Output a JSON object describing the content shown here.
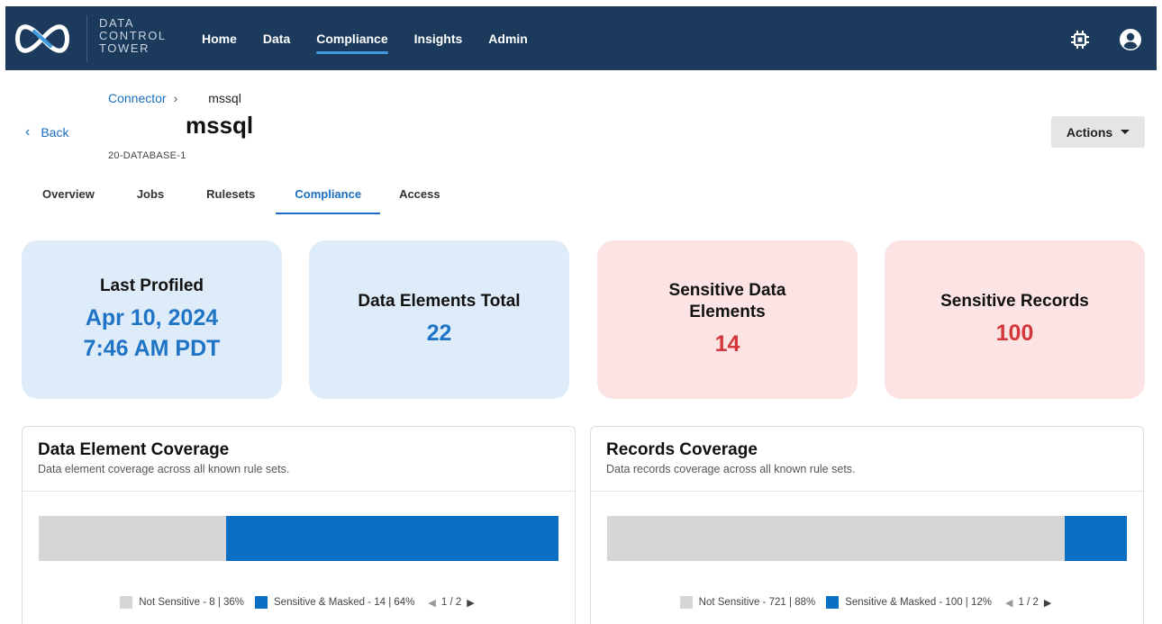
{
  "brand": {
    "line1": "DATA",
    "line2": "CONTROL",
    "line3": "TOWER"
  },
  "nav": {
    "items": [
      {
        "label": "Home"
      },
      {
        "label": "Data"
      },
      {
        "label": "Compliance",
        "active": true
      },
      {
        "label": "Insights"
      },
      {
        "label": "Admin"
      }
    ]
  },
  "header": {
    "breadcrumb_parent": "Connector",
    "breadcrumb_sep": "›",
    "breadcrumb_current": "mssql",
    "back_label": "Back",
    "title": "mssql",
    "subtitle": "20-DATABASE-1",
    "actions_label": "Actions"
  },
  "tabs": [
    {
      "label": "Overview"
    },
    {
      "label": "Jobs"
    },
    {
      "label": "Rulesets"
    },
    {
      "label": "Compliance",
      "active": true
    },
    {
      "label": "Access"
    }
  ],
  "stats": {
    "last_profiled": {
      "label": "Last Profiled",
      "value_line1": "Apr 10, 2024",
      "value_line2": "7:46 AM PDT"
    },
    "data_elements_total": {
      "label": "Data Elements Total",
      "value": "22"
    },
    "sensitive_data_elements": {
      "label_line1": "Sensitive Data",
      "label_line2": "Elements",
      "value": "14"
    },
    "sensitive_records": {
      "label": "Sensitive Records",
      "value": "100"
    }
  },
  "colors": {
    "nav_bg": "#1b3a5c",
    "accent": "#1a6fc0",
    "not_sensitive": "#d6d6d6",
    "sensitive_masked": "#0a6fc2",
    "sensitive_value": "#d4373a"
  },
  "element_coverage": {
    "title": "Data Element Coverage",
    "description": "Data element coverage across all known rule sets.",
    "not_sensitive_fraction": 0.36,
    "sensitive_fraction": 0.64,
    "legend_not_sensitive": "Not Sensitive - 8 | 36%",
    "legend_sensitive": "Sensitive & Masked - 14 | 64%",
    "pager": "1 / 2"
  },
  "records_coverage": {
    "title": "Records Coverage",
    "description": "Data records coverage across all known rule sets.",
    "not_sensitive_fraction": 0.88,
    "sensitive_fraction": 0.12,
    "legend_not_sensitive": "Not Sensitive - 721 | 88%",
    "legend_sensitive": "Sensitive & Masked - 100 | 12%",
    "pager": "1 / 2"
  },
  "icons": {
    "logo": "infinity-logo-icon",
    "chip": "chip-icon",
    "user": "user-circle-icon",
    "back": "chevron-left-icon",
    "actions": "caret-down-icon",
    "pager_prev": "triangle-left-icon",
    "pager_next": "triangle-right-icon"
  }
}
